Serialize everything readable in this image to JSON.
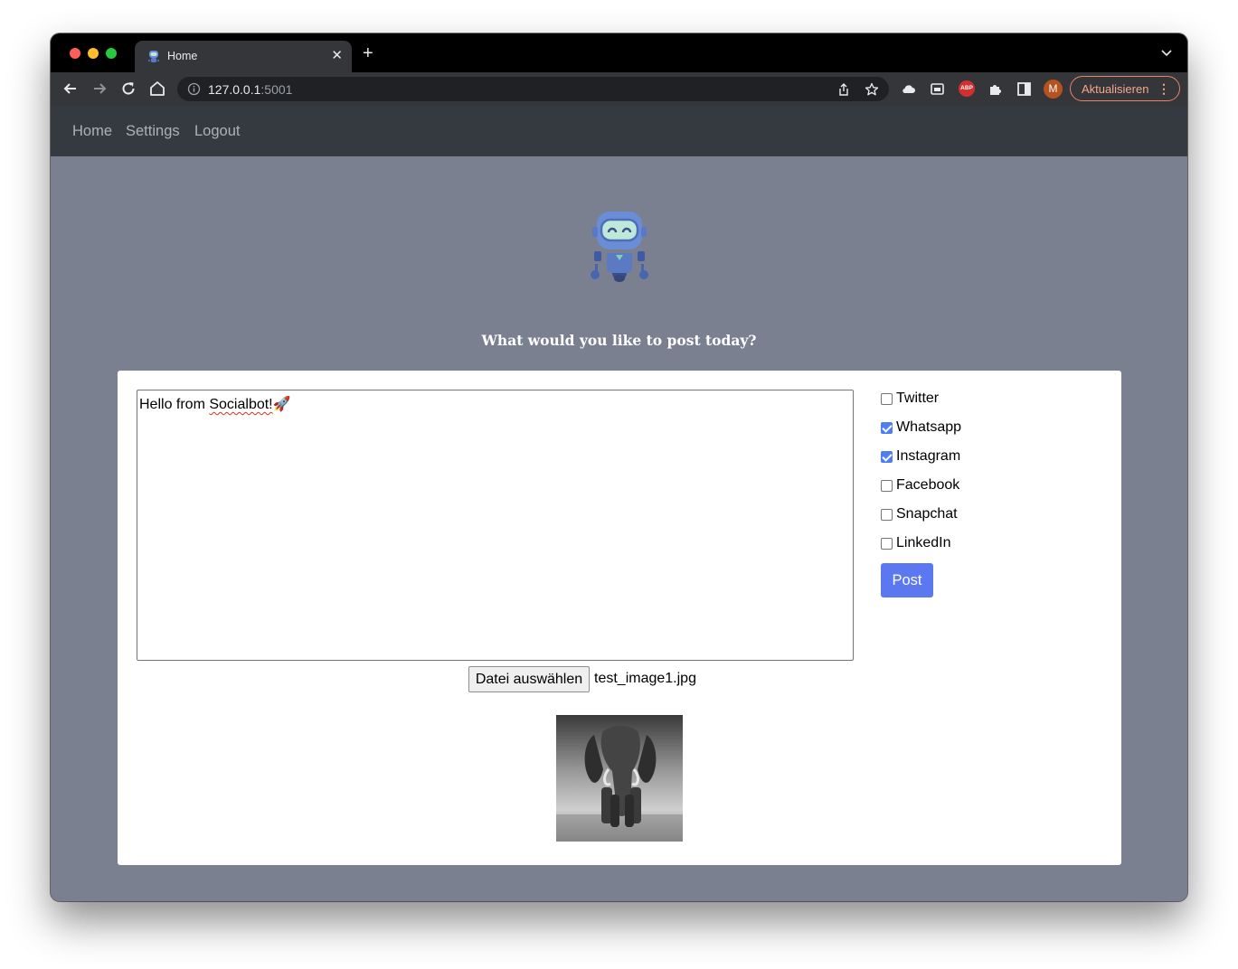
{
  "browser": {
    "tab_title": "Home",
    "url_host": "127.0.0.1",
    "url_port": ":5001",
    "update_button": "Aktualisieren",
    "avatar_initial": "M",
    "abp_badge": "ABP"
  },
  "navbar": {
    "links": [
      "Home",
      "Settings",
      "Logout"
    ]
  },
  "main": {
    "prompt": "What would you like to post today?",
    "post_text_prefix": "Hello from ",
    "post_text_word": "Socialbot!",
    "post_text_emoji": "🚀",
    "file_button": "Datei auswählen",
    "file_name": "test_image1.jpg",
    "platforms": [
      {
        "label": "Twitter",
        "checked": false
      },
      {
        "label": "Whatsapp",
        "checked": true
      },
      {
        "label": "Instagram",
        "checked": true
      },
      {
        "label": "Facebook",
        "checked": false
      },
      {
        "label": "Snapchat",
        "checked": false
      },
      {
        "label": "LinkedIn",
        "checked": false
      }
    ],
    "post_button": "Post"
  },
  "colors": {
    "page_bg": "#7a8090",
    "navbar_bg": "#343a40",
    "accent": "#5b78f0"
  }
}
